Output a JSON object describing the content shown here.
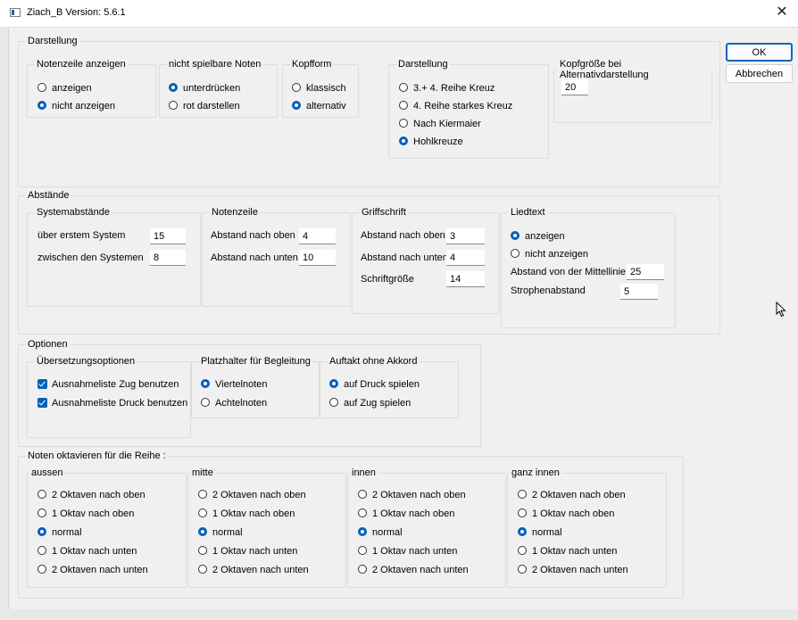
{
  "window": {
    "title": "Ziach_B  Version: 5.6.1",
    "close_glyph": "✕"
  },
  "buttons": {
    "ok": "OK",
    "cancel": "Abbrechen"
  },
  "darstellung": {
    "legend": "Darstellung",
    "notenzeile": {
      "legend": "Notenzeile anzeigen",
      "options": [
        "anzeigen",
        "nicht anzeigen"
      ],
      "selected": 1
    },
    "nicht_spielbar": {
      "legend": "nicht spielbare Noten",
      "options": [
        "unterdrücken",
        "rot darstellen"
      ],
      "selected": 0
    },
    "kopfform": {
      "legend": "Kopfform",
      "options": [
        "klassisch",
        "alternativ"
      ],
      "selected": 1
    },
    "darst": {
      "legend": "Darstellung",
      "options": [
        "3.+ 4. Reihe Kreuz",
        "4. Reihe starkes Kreuz",
        "Nach Kiermaier",
        "Hohlkreuze"
      ],
      "selected": 3
    },
    "kopfgroesse": {
      "legend": "Kopfgröße bei Alternativdarstellung",
      "value": "20"
    }
  },
  "abstaende": {
    "legend": "Abstände",
    "system": {
      "legend": "Systemabstände",
      "first_label": "über erstem System",
      "first_value": "15",
      "between_label": "zwischen den Systemen",
      "between_value": "8"
    },
    "notenzeile": {
      "legend": "Notenzeile",
      "top_label": "Abstand nach oben",
      "top_value": "4",
      "bottom_label": "Abstand nach unten",
      "bottom_value": "10"
    },
    "griffschrift": {
      "legend": "Griffschrift",
      "top_label": "Abstand nach oben",
      "top_value": "3",
      "bottom_label": "Abstand nach unten",
      "bottom_value": "4",
      "size_label": "Schriftgröße",
      "size_value": "14"
    },
    "liedtext": {
      "legend": "Liedtext",
      "options": [
        "anzeigen",
        "nicht anzeigen"
      ],
      "selected": 0,
      "mittellinie_label": "Abstand von der Mittellinie",
      "mittellinie_value": "25",
      "strophen_label": "Strophenabstand",
      "strophen_value": "5"
    }
  },
  "optionen": {
    "legend": "Optionen",
    "uebersetzung": {
      "legend": "Übersetzungsoptionen",
      "checks": [
        "Ausnahmeliste Zug benutzen",
        "Ausnahmeliste Druck benutzen"
      ]
    },
    "platzhalter": {
      "legend": "Platzhalter für Begleitung",
      "options": [
        "Viertelnoten",
        "Achtelnoten"
      ],
      "selected": 0
    },
    "auftakt": {
      "legend": "Auftakt ohne Akkord",
      "options": [
        "auf Druck spielen",
        "auf Zug spielen"
      ],
      "selected": 0
    }
  },
  "oktavieren": {
    "legend": "Noten oktavieren für die Reihe :",
    "options": [
      "2 Oktaven nach oben",
      "1 Oktav nach oben",
      "normal",
      "1 Oktav nach unten",
      "2 Oktaven nach unten"
    ],
    "rows": [
      {
        "legend": "aussen",
        "selected": 2
      },
      {
        "legend": "mitte",
        "selected": 2
      },
      {
        "legend": "innen",
        "selected": 2
      },
      {
        "legend": "ganz innen",
        "selected": 2
      }
    ]
  }
}
